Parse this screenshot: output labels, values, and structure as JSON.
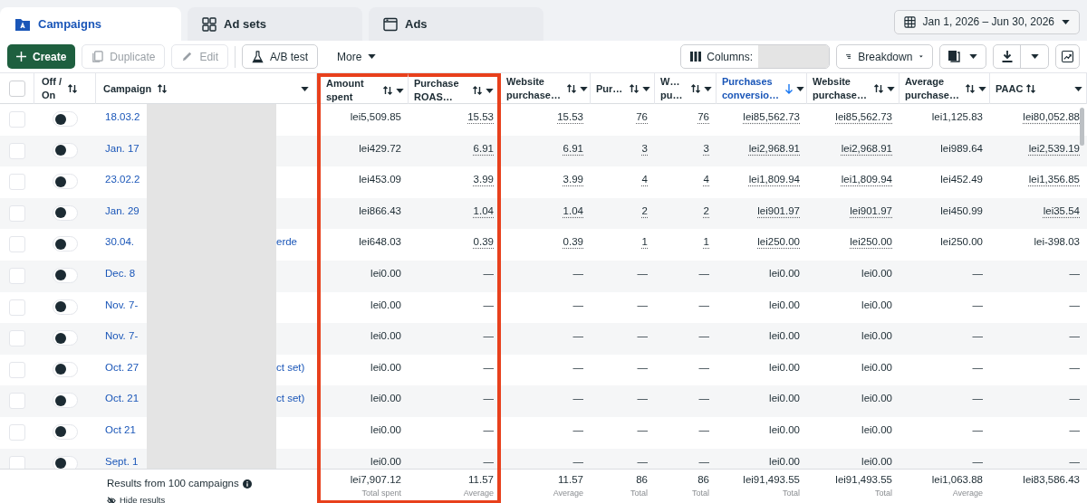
{
  "tabs": [
    {
      "label": "Campaigns",
      "kind": "campaigns",
      "selected": true
    },
    {
      "label": "Ad sets",
      "kind": "adsets",
      "selected": false
    },
    {
      "label": "Ads",
      "kind": "ads",
      "selected": false
    }
  ],
  "date_range": "Jan 1, 2026 – Jun 30, 2026",
  "toolbar": {
    "left": [
      {
        "label": "Create",
        "kind": "create",
        "disabled": false
      },
      {
        "label": "Duplicate",
        "kind": "duplicate",
        "disabled": true
      },
      {
        "label": "Edit",
        "kind": "edit",
        "disabled": true
      },
      {
        "label": "A/B test",
        "kind": "abtest",
        "disabled": false
      },
      {
        "label": "More",
        "kind": "more",
        "disabled": false
      }
    ],
    "columns_label": "Columns:",
    "breakdown_label": "Breakdown"
  },
  "table": {
    "all_selected": false,
    "fixed_columns": [
      {
        "label": [
          "Off /",
          "On"
        ]
      },
      {
        "label": [
          "Campaign"
        ]
      }
    ],
    "columns": [
      {
        "label": [
          "Amount",
          "spent"
        ],
        "sorted": false,
        "highlighted": true,
        "total": "lei7,907.12",
        "caption": "Total spent"
      },
      {
        "label": [
          "Purchase",
          "ROAS…"
        ],
        "sorted": false,
        "highlighted": true,
        "total": "11.57",
        "caption": "Average"
      },
      {
        "label": [
          "Website",
          "purchase…"
        ],
        "sorted": false,
        "highlighted": false,
        "total": "11.57",
        "caption": "Average"
      },
      {
        "label": [
          "Pur…"
        ],
        "sorted": false,
        "highlighted": false,
        "total": "86",
        "caption": "Total"
      },
      {
        "label": [
          "W…",
          "pu…"
        ],
        "sorted": false,
        "highlighted": false,
        "total": "86",
        "caption": "Total"
      },
      {
        "label": [
          "Purchases",
          "conversio…"
        ],
        "sorted": true,
        "highlighted": false,
        "total": "lei91,493.55",
        "caption": "Total"
      },
      {
        "label": [
          "Website",
          "purchase…"
        ],
        "sorted": false,
        "highlighted": false,
        "total": "lei91,493.55",
        "caption": "Total"
      },
      {
        "label": [
          "Average",
          "purchase…"
        ],
        "sorted": false,
        "highlighted": false,
        "total": "lei1,063.88",
        "caption": "Average"
      },
      {
        "label": [
          "PAAC"
        ],
        "sorted": false,
        "highlighted": false,
        "total": "lei83,586.43"
      }
    ],
    "rows": [
      {
        "checked": false,
        "on": false,
        "name": "18.03.2",
        "values": [
          "lei5,509.85",
          "15.53",
          "15.53",
          "76",
          "76",
          "lei85,562.73",
          "lei85,562.73",
          "lei1,125.83",
          "lei80,052.88"
        ],
        "dotted": [
          false,
          true,
          true,
          true,
          true,
          true,
          true,
          false,
          true
        ]
      },
      {
        "checked": false,
        "on": false,
        "name": "Jan. 17",
        "values": [
          "lei429.72",
          "6.91",
          "6.91",
          "3",
          "3",
          "lei2,968.91",
          "lei2,968.91",
          "lei989.64",
          "lei2,539.19"
        ],
        "dotted": [
          false,
          true,
          true,
          true,
          true,
          true,
          true,
          false,
          true
        ]
      },
      {
        "checked": false,
        "on": false,
        "name": "23.02.2",
        "values": [
          "lei453.09",
          "3.99",
          "3.99",
          "4",
          "4",
          "lei1,809.94",
          "lei1,809.94",
          "lei452.49",
          "lei1,356.85"
        ],
        "dotted": [
          false,
          true,
          true,
          true,
          true,
          true,
          true,
          false,
          true
        ]
      },
      {
        "checked": false,
        "on": false,
        "name": "Jan. 29",
        "values": [
          "lei866.43",
          "1.04",
          "1.04",
          "2",
          "2",
          "lei901.97",
          "lei901.97",
          "lei450.99",
          "lei35.54"
        ],
        "dotted": [
          false,
          true,
          true,
          true,
          true,
          true,
          true,
          false,
          true
        ]
      },
      {
        "checked": false,
        "on": false,
        "name": "30.04.",
        "name_tail": "erde",
        "values": [
          "lei648.03",
          "0.39",
          "0.39",
          "1",
          "1",
          "lei250.00",
          "lei250.00",
          "lei250.00",
          "lei-398.03"
        ],
        "dotted": [
          false,
          true,
          true,
          true,
          true,
          true,
          true,
          false,
          false
        ]
      },
      {
        "checked": false,
        "on": false,
        "name": "Dec. 8",
        "values": [
          "lei0.00",
          "—",
          "—",
          "—",
          "—",
          "lei0.00",
          "lei0.00",
          "—",
          "—"
        ]
      },
      {
        "checked": false,
        "on": false,
        "name": "Nov. 7-",
        "values": [
          "lei0.00",
          "—",
          "—",
          "—",
          "—",
          "lei0.00",
          "lei0.00",
          "—",
          "—"
        ]
      },
      {
        "checked": false,
        "on": false,
        "name": "Nov. 7-",
        "values": [
          "lei0.00",
          "—",
          "—",
          "—",
          "—",
          "lei0.00",
          "lei0.00",
          "—",
          "—"
        ]
      },
      {
        "checked": false,
        "on": false,
        "name": "Oct. 27",
        "name_tail": "ct set)",
        "values": [
          "lei0.00",
          "—",
          "—",
          "—",
          "—",
          "lei0.00",
          "lei0.00",
          "—",
          "—"
        ]
      },
      {
        "checked": false,
        "on": false,
        "name": "Oct. 21",
        "name_tail": "ct set)",
        "values": [
          "lei0.00",
          "—",
          "—",
          "—",
          "—",
          "lei0.00",
          "lei0.00",
          "—",
          "—"
        ]
      },
      {
        "checked": false,
        "on": false,
        "name": "Oct 21",
        "values": [
          "lei0.00",
          "—",
          "—",
          "—",
          "—",
          "lei0.00",
          "lei0.00",
          "—",
          "—"
        ]
      },
      {
        "checked": false,
        "on": false,
        "name": "Sept. 1",
        "values": [
          "lei0.00",
          "—",
          "—",
          "—",
          "—",
          "lei0.00",
          "lei0.00",
          "—",
          "—"
        ]
      }
    ],
    "summary": "Results from 100 campaigns",
    "hide_label": "Hide results"
  }
}
